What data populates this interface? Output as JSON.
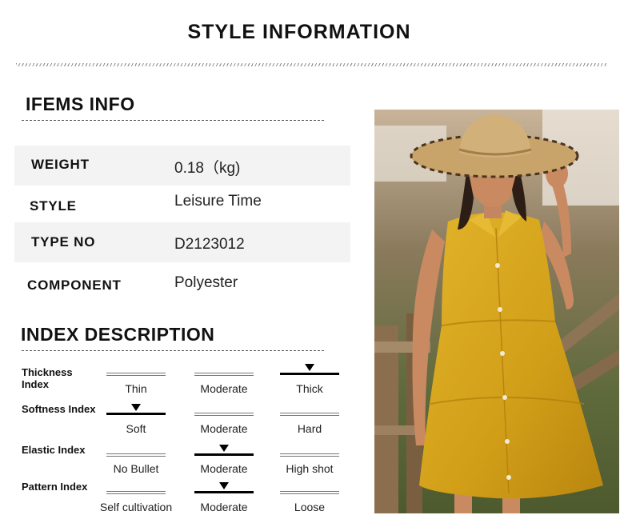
{
  "header": {
    "title": "STYLE INFORMATION"
  },
  "items_info": {
    "title": "IFEMS INFO",
    "rows": [
      {
        "key": "WEIGHT",
        "value": "0.18（kg)"
      },
      {
        "key": "STYLE",
        "value": "Leisure Time"
      },
      {
        "key": "TYPE NO",
        "value": "D2123012"
      },
      {
        "key": "COMPONENT",
        "value": "Polyester"
      }
    ]
  },
  "index_description": {
    "title": "INDEX DESCRIPTION",
    "indexes": [
      {
        "label": "Thickness Index",
        "options": [
          "Thin",
          "Moderate",
          "Thick"
        ],
        "selected": 2
      },
      {
        "label": "Softness Index",
        "options": [
          "Soft",
          "Moderate",
          "Hard"
        ],
        "selected": 0
      },
      {
        "label": "Elastic Index",
        "options": [
          "No Bullet",
          "Moderate",
          "High shot"
        ],
        "selected": 1
      },
      {
        "label": "Pattern Index",
        "options": [
          "Self cultivation",
          "Moderate",
          "Loose"
        ],
        "selected": 1
      }
    ]
  },
  "photo": {
    "description": "model-in-yellow-sleeveless-dress-and-straw-hat"
  },
  "colors": {
    "dress": "#d9a91c",
    "shade_row": "#f3f3f3",
    "text": "#111111"
  }
}
